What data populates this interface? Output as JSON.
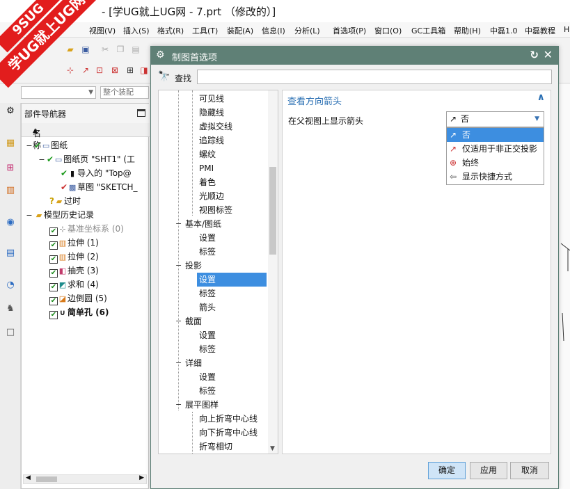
{
  "window": {
    "title": "- [学UG就上UG网 - 7.prt （修改的）]"
  },
  "logo": {
    "line1": "9SUG",
    "line2": "学UG就上UG网"
  },
  "menu": [
    "视图(V)",
    "插入(S)",
    "格式(R)",
    "工具(T)",
    "装配(A)",
    "信息(I)",
    "分析(L)",
    "首选项(P)",
    "窗口(O)",
    "GC工具箱",
    "帮助(H)",
    "中磊1.0",
    "中磊教程",
    "H"
  ],
  "toolbar": {
    "assembly_combo": "整个装配"
  },
  "navigator": {
    "title": "部件导航器",
    "column": "名称",
    "rows": [
      {
        "label": "图纸",
        "indent": 0
      },
      {
        "label": "图纸页 \"SHT1\" (工",
        "indent": 1
      },
      {
        "label": "导入的 \"Top@",
        "indent": 2
      },
      {
        "label": "草图 \"SKETCH_",
        "indent": 2
      },
      {
        "label": "过时",
        "indent": 1
      },
      {
        "label": "模型历史记录",
        "indent": 0
      },
      {
        "label": "基准坐标系 (0)",
        "indent": 1,
        "gray": true
      },
      {
        "label": "拉伸 (1)",
        "indent": 1
      },
      {
        "label": "拉伸 (2)",
        "indent": 1
      },
      {
        "label": "抽壳 (3)",
        "indent": 1
      },
      {
        "label": "求和 (4)",
        "indent": 1
      },
      {
        "label": "边倒圆 (5)",
        "indent": 1
      },
      {
        "label": "简单孔 (6)",
        "indent": 1,
        "bold": true
      }
    ]
  },
  "dialog": {
    "title": "制图首选项",
    "find_label": "查找",
    "find_value": "",
    "tree": [
      {
        "label": "可见线",
        "level": 2
      },
      {
        "label": "隐藏线",
        "level": 2
      },
      {
        "label": "虚拟交线",
        "level": 2
      },
      {
        "label": "追踪线",
        "level": 2
      },
      {
        "label": "螺纹",
        "level": 2
      },
      {
        "label": "PMI",
        "level": 2
      },
      {
        "label": "着色",
        "level": 2
      },
      {
        "label": "光顺边",
        "level": 2
      },
      {
        "label": "视图标签",
        "level": 2
      },
      {
        "label": "基本/图纸",
        "level": 1
      },
      {
        "label": "设置",
        "level": 2
      },
      {
        "label": "标签",
        "level": 2
      },
      {
        "label": "投影",
        "level": 1
      },
      {
        "label": "设置",
        "level": 2,
        "selected": true
      },
      {
        "label": "标签",
        "level": 2
      },
      {
        "label": "箭头",
        "level": 2
      },
      {
        "label": "截面",
        "level": 1
      },
      {
        "label": "设置",
        "level": 2
      },
      {
        "label": "标签",
        "level": 2
      },
      {
        "label": "详细",
        "level": 1
      },
      {
        "label": "设置",
        "level": 2
      },
      {
        "label": "标签",
        "level": 2
      },
      {
        "label": "展平图样",
        "level": 1
      },
      {
        "label": "向上折弯中心线",
        "level": 2
      },
      {
        "label": "向下折弯中心线",
        "level": 2
      },
      {
        "label": "折弯相切",
        "level": 2
      }
    ],
    "group_title": "查看方向箭头",
    "field_label": "在父视图上显示箭头",
    "field_value": "否",
    "options": [
      "否",
      "仅适用于非正交投影",
      "始终",
      "显示快捷方式"
    ],
    "buttons": {
      "ok": "确定",
      "apply": "应用",
      "cancel": "取消"
    }
  }
}
